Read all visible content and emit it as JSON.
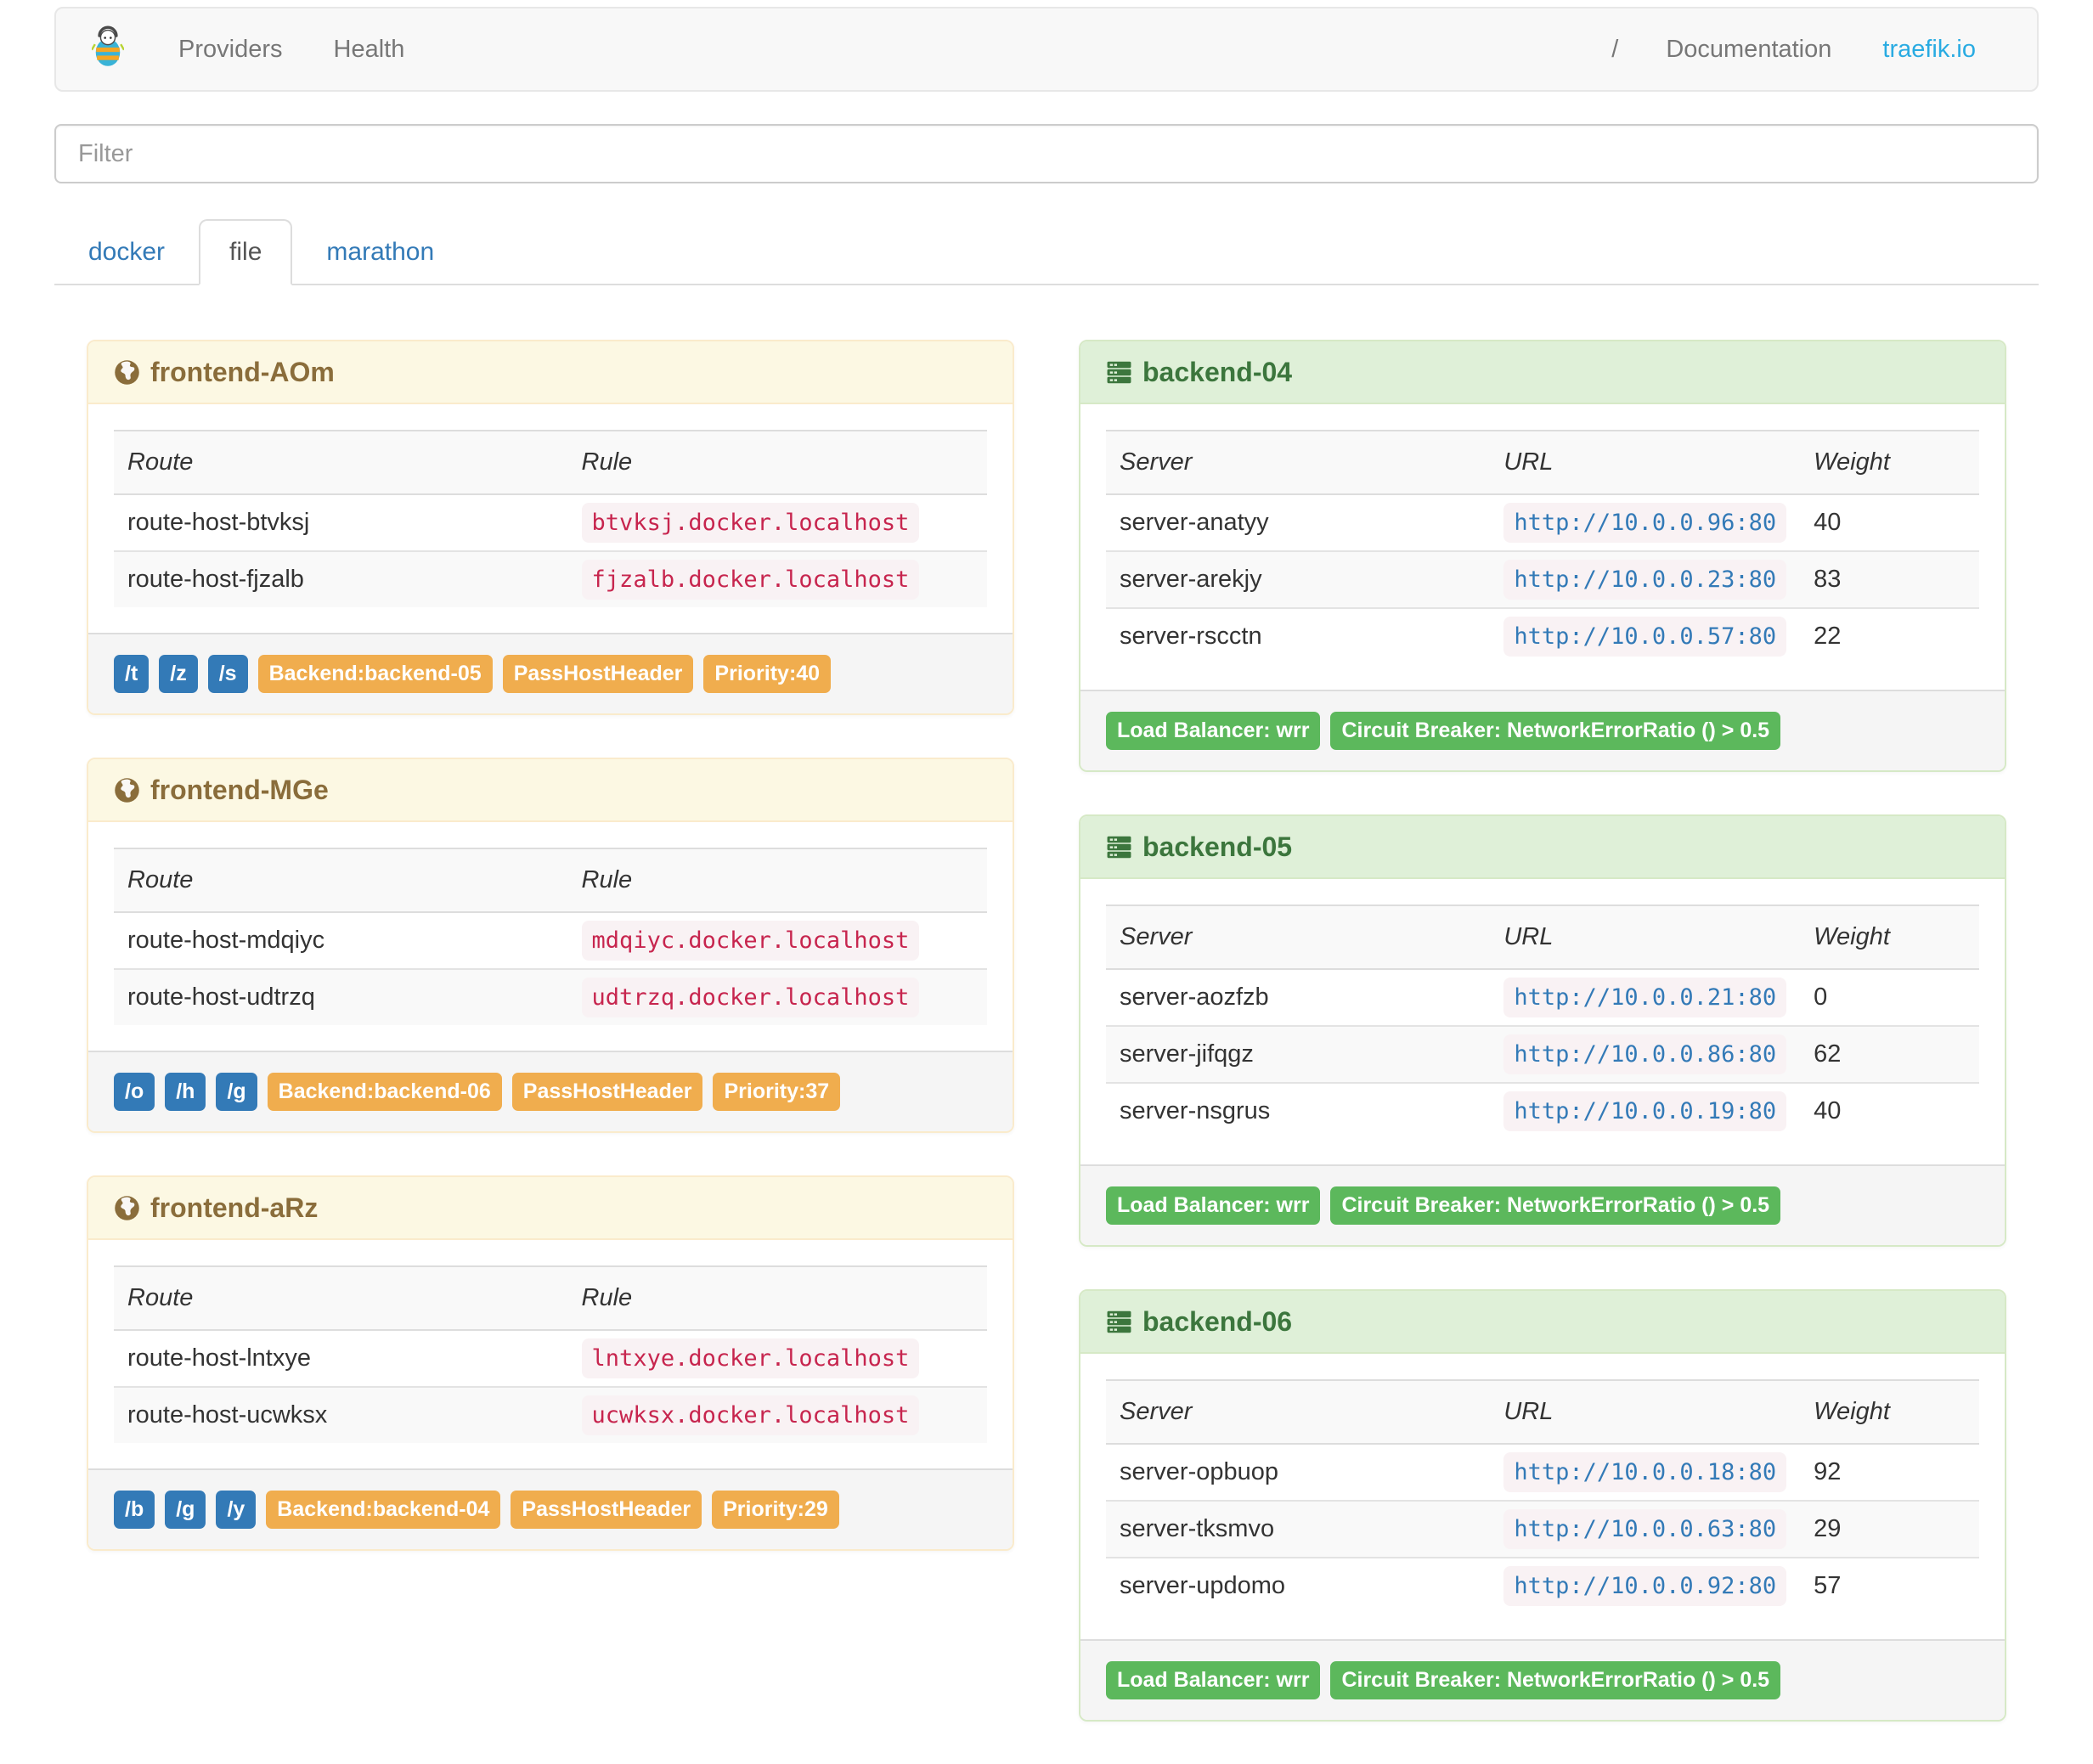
{
  "navbar": {
    "providers_label": "Providers",
    "health_label": "Health",
    "separator": "/",
    "documentation_label": "Documentation",
    "site_label": "traefik.io"
  },
  "filter": {
    "placeholder": "Filter"
  },
  "tabs": [
    {
      "label": "docker",
      "active": false
    },
    {
      "label": "file",
      "active": true
    },
    {
      "label": "marathon",
      "active": false
    }
  ],
  "frontends": {
    "columns": [
      "Route",
      "Rule"
    ],
    "cards": [
      {
        "title": "frontend-AOm",
        "routes": [
          {
            "route": "route-host-btvksj",
            "rule": "btvksj.docker.localhost"
          },
          {
            "route": "route-host-fjzalb",
            "rule": "fjzalb.docker.localhost"
          }
        ],
        "entry_points": [
          "/t",
          "/z",
          "/s"
        ],
        "tags": [
          "Backend:backend-05",
          "PassHostHeader",
          "Priority:40"
        ]
      },
      {
        "title": "frontend-MGe",
        "routes": [
          {
            "route": "route-host-mdqiyc",
            "rule": "mdqiyc.docker.localhost"
          },
          {
            "route": "route-host-udtrzq",
            "rule": "udtrzq.docker.localhost"
          }
        ],
        "entry_points": [
          "/o",
          "/h",
          "/g"
        ],
        "tags": [
          "Backend:backend-06",
          "PassHostHeader",
          "Priority:37"
        ]
      },
      {
        "title": "frontend-aRz",
        "routes": [
          {
            "route": "route-host-lntxye",
            "rule": "lntxye.docker.localhost"
          },
          {
            "route": "route-host-ucwksx",
            "rule": "ucwksx.docker.localhost"
          }
        ],
        "entry_points": [
          "/b",
          "/g",
          "/y"
        ],
        "tags": [
          "Backend:backend-04",
          "PassHostHeader",
          "Priority:29"
        ]
      }
    ]
  },
  "backends": {
    "columns": [
      "Server",
      "URL",
      "Weight"
    ],
    "cards": [
      {
        "title": "backend-04",
        "servers": [
          {
            "server": "server-anatyy",
            "url": "http://10.0.0.96:80",
            "weight": "40"
          },
          {
            "server": "server-arekjy",
            "url": "http://10.0.0.23:80",
            "weight": "83"
          },
          {
            "server": "server-rscctn",
            "url": "http://10.0.0.57:80",
            "weight": "22"
          }
        ],
        "tags": [
          "Load Balancer: wrr",
          "Circuit Breaker: NetworkErrorRatio () > 0.5"
        ]
      },
      {
        "title": "backend-05",
        "servers": [
          {
            "server": "server-aozfzb",
            "url": "http://10.0.0.21:80",
            "weight": "0"
          },
          {
            "server": "server-jifqgz",
            "url": "http://10.0.0.86:80",
            "weight": "62"
          },
          {
            "server": "server-nsgrus",
            "url": "http://10.0.0.19:80",
            "weight": "40"
          }
        ],
        "tags": [
          "Load Balancer: wrr",
          "Circuit Breaker: NetworkErrorRatio () > 0.5"
        ]
      },
      {
        "title": "backend-06",
        "servers": [
          {
            "server": "server-opbuop",
            "url": "http://10.0.0.18:80",
            "weight": "92"
          },
          {
            "server": "server-tksmvo",
            "url": "http://10.0.0.63:80",
            "weight": "29"
          },
          {
            "server": "server-updomo",
            "url": "http://10.0.0.92:80",
            "weight": "57"
          }
        ],
        "tags": [
          "Load Balancer: wrr",
          "Circuit Breaker: NetworkErrorRatio () > 0.5"
        ]
      }
    ]
  },
  "icons": {
    "brand": "traefik-logo",
    "frontend": "globe-icon",
    "backend": "server-icon"
  },
  "colors": {
    "brand_link": "#29abe2",
    "primary_label": "#337ab7",
    "warning_label": "#f0ad4e",
    "success_label": "#5cb85c",
    "frontend_heading_bg": "#fcf8e3",
    "frontend_heading_text": "#8a6d3b",
    "backend_heading_bg": "#dff0d8",
    "backend_heading_text": "#3c763d",
    "rule_code_text": "#c7254e",
    "url_code_text": "#337ab7",
    "code_bg": "#f9f2f4"
  }
}
